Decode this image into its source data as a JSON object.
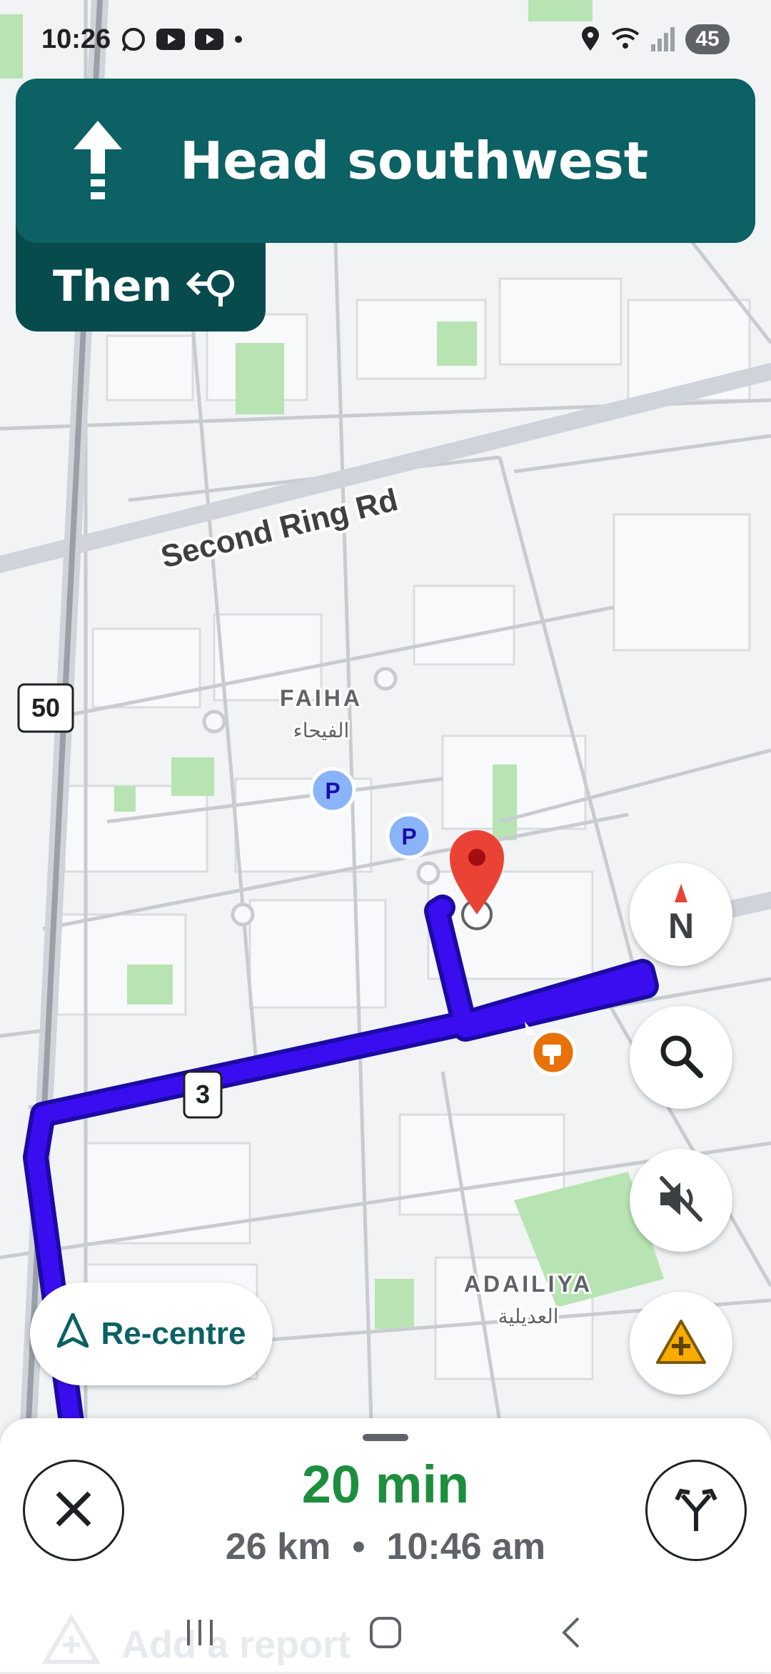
{
  "status_bar": {
    "time": "10:26",
    "icons": [
      "whatsapp-icon",
      "youtube-icon",
      "youtube-icon",
      "dot-icon"
    ],
    "right_icons": [
      "location-icon",
      "wifi-icon",
      "signal-icon"
    ],
    "battery": "45"
  },
  "navigation": {
    "instruction": "Head southwest",
    "direction_icon": "straight-arrow-icon",
    "then_label": "Then",
    "then_icon": "u-turn-left-icon"
  },
  "map": {
    "road_label": "Second Ring Rd",
    "shield_50": "50",
    "shield_3": "3",
    "district_1_en": "FAIHA",
    "district_1_ar": "الفيحاء",
    "district_2_en": "ADAILIYA",
    "district_2_ar": "العديلية",
    "parking_label": "P",
    "route_color": "#3a0df0",
    "destination_pin_color": "#ea4335"
  },
  "controls": {
    "compass_label": "N",
    "recentre_label": "Re-centre"
  },
  "trip": {
    "duration": "20 min",
    "distance": "26 km",
    "separator": "•",
    "arrival_time": "10:46 am"
  },
  "ghost_report_label": "Add a report",
  "colors": {
    "banner": "#0b6163",
    "then_box": "#084b4d",
    "eta_green": "#1e8e3e"
  }
}
